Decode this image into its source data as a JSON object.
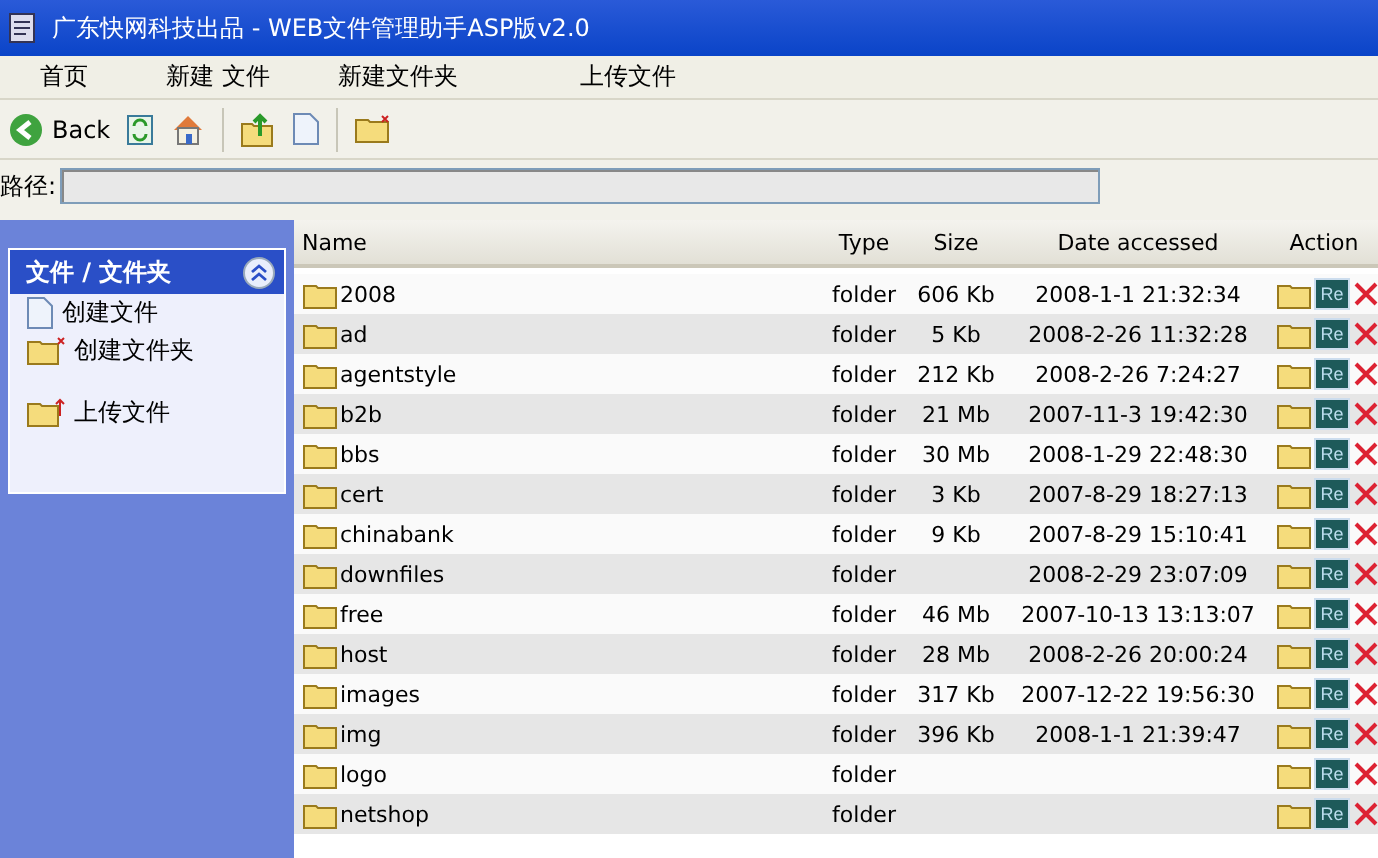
{
  "window": {
    "title": "广东快网科技出品 - WEB文件管理助手ASP版v2.0"
  },
  "menu": [
    "首页",
    "新建 文件",
    "新建文件夹",
    "上传文件"
  ],
  "toolbar": {
    "back": "Back"
  },
  "path": {
    "label": "路径:"
  },
  "sidebar": {
    "title": "文件 / 文件夹",
    "items": [
      {
        "kind": "file",
        "label": "创建文件"
      },
      {
        "kind": "newfolder",
        "label": "创建文件夹"
      },
      {
        "kind": "upload",
        "label": "上传文件"
      }
    ]
  },
  "table": {
    "columns": [
      "Name",
      "Type",
      "Size",
      "Date accessed",
      "Action"
    ],
    "rows": [
      {
        "name": "2008",
        "type": "folder",
        "size": "606 Kb",
        "date": "2008-1-1 21:32:34",
        "rename": "Re"
      },
      {
        "name": "ad",
        "type": "folder",
        "size": "5 Kb",
        "date": "2008-2-26 11:32:28",
        "rename": "Re"
      },
      {
        "name": "agentstyle",
        "type": "folder",
        "size": "212 Kb",
        "date": "2008-2-26 7:24:27",
        "rename": "Re"
      },
      {
        "name": "b2b",
        "type": "folder",
        "size": "21 Mb",
        "date": "2007-11-3 19:42:30",
        "rename": "Re"
      },
      {
        "name": "bbs",
        "type": "folder",
        "size": "30 Mb",
        "date": "2008-1-29 22:48:30",
        "rename": "Re"
      },
      {
        "name": "cert",
        "type": "folder",
        "size": "3 Kb",
        "date": "2007-8-29 18:27:13",
        "rename": "Re"
      },
      {
        "name": "chinabank",
        "type": "folder",
        "size": "9 Kb",
        "date": "2007-8-29 15:10:41",
        "rename": "Re"
      },
      {
        "name": "downfiles",
        "type": "folder",
        "date": "2008-2-29 23:07:09",
        "rename": "Re"
      },
      {
        "name": "free",
        "type": "folder",
        "size": "46 Mb",
        "date": "2007-10-13 13:13:07",
        "rename": "Re"
      },
      {
        "name": "host",
        "type": "folder",
        "size": "28 Mb",
        "date": "2008-2-26 20:00:24",
        "rename": "Re"
      },
      {
        "name": "images",
        "type": "folder",
        "size": "317 Kb",
        "date": "2007-12-22 19:56:30",
        "rename": "Re"
      },
      {
        "name": "img",
        "type": "folder",
        "size": "396 Kb",
        "date": "2008-1-1 21:39:47",
        "rename": "Re"
      },
      {
        "name": "logo",
        "type": "folder",
        "rename": "Re"
      },
      {
        "name": "netshop",
        "type": "folder",
        "rename": "Re"
      }
    ]
  }
}
